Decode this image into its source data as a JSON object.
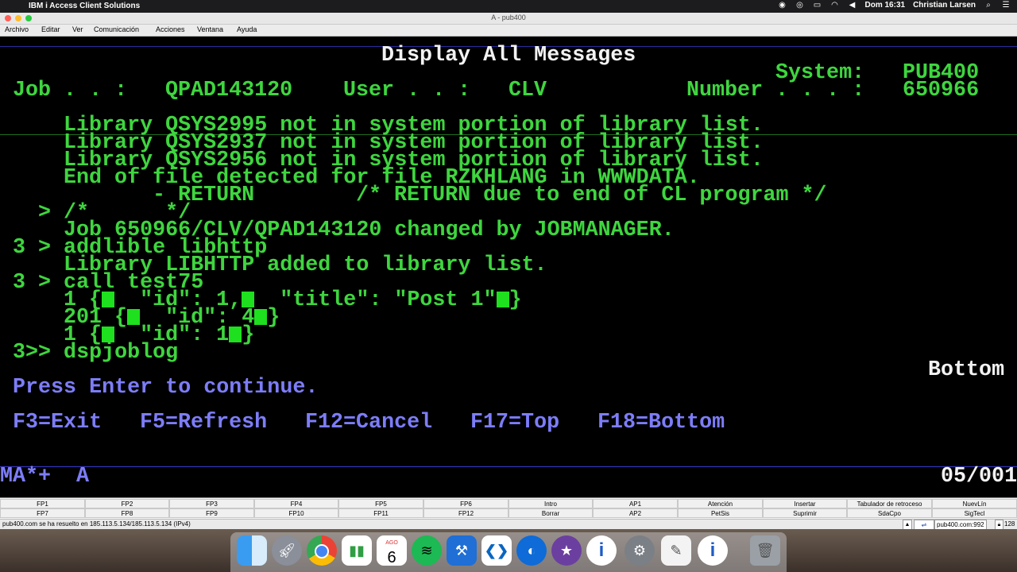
{
  "menubar": {
    "app_name": "IBM i Access Client Solutions",
    "clock": "Dom 16:31",
    "user": "Christian Larsen",
    "apple_icon": "apple-icon",
    "status_icons": [
      "record-icon",
      "airdrop-icon",
      "airplay-icon",
      "wifi-icon",
      "volume-icon"
    ]
  },
  "window": {
    "title": "A - pub400"
  },
  "app_menu": [
    "Archivo",
    "Editar",
    "Ver",
    "Comunicación",
    "Acciones",
    "Ventana",
    "Ayuda"
  ],
  "terminal": {
    "screen_title": "Display All Messages",
    "system_label": "System:",
    "system_value": "PUB400",
    "job_label": "Job . . :",
    "job_value": "QPAD143120",
    "user_label": "User . . :",
    "user_value": "CLV",
    "number_label": "Number . . . :",
    "number_value": "650966",
    "messages": [
      "Library QSYS2995 not in system portion of library list.",
      "Library QSYS2937 not in system portion of library list.",
      "Library QSYS2956 not in system portion of library list.",
      "End of file detected for file RZKHLANG in WWWDATA.",
      "- RETURN",
      "/* RETURN due to end of CL program */",
      "> /*      */",
      "Job 650966/CLV/QPAD143120 changed by JOBMANAGER.",
      "3 > addlible libhttp",
      "Library LIBHTTP added to library list.",
      "3 > call test75",
      "1 {",
      "\"id\": 1,",
      "\"title\": \"Post 1\"",
      "}",
      "201 {",
      "\"id\": 4",
      "}",
      "1 {",
      "\"id\": 1",
      "}",
      "3>> dspjoblog"
    ],
    "more_indicator": "Bottom",
    "prompt": "Press Enter to continue.",
    "function_keys": [
      "F3=Exit",
      "F5=Refresh",
      "F12=Cancel",
      "F17=Top",
      "F18=Bottom"
    ],
    "oia_left": "MA*+",
    "oia_session": "A",
    "cursor_position": "05/001"
  },
  "keypad": {
    "row1": [
      "FP1",
      "FP2",
      "FP3",
      "FP4",
      "FP5",
      "FP6",
      "Intro",
      "AP1",
      "Atención",
      "Insertar",
      "Tabulador de retroceso",
      "NuevLín"
    ],
    "row2": [
      "FP7",
      "FP8",
      "FP9",
      "FP10",
      "FP11",
      "FP12",
      "Borrar",
      "AP2",
      "PetSis",
      "Suprimir",
      "SdaCpo",
      "SigTecl"
    ]
  },
  "statusbar": {
    "message": "pub400.com se ha resuelto en 185.113.5.134/185.113.5.134 (IPv4)",
    "host_port": "pub400.com:992",
    "cipher_bits": "128"
  },
  "dock": {
    "calendar_month": "AGO",
    "calendar_day": "6",
    "icons": [
      "finder-icon",
      "launchpad-icon",
      "chrome-icon",
      "numbers-icon",
      "calendar-icon",
      "spotify-icon",
      "xcode-icon",
      "vscode-icon",
      "edge-icon",
      "imovie-icon",
      "ibm-i-acs-icon",
      "system-preferences-icon",
      "textedit-icon",
      "ibm-i-acs-icon-2",
      "trash-icon"
    ]
  },
  "colors": {
    "term_green": "#3ed63e",
    "term_white": "#f2f2f2",
    "term_blue": "#7d7dfa",
    "term_bg": "#000000"
  }
}
